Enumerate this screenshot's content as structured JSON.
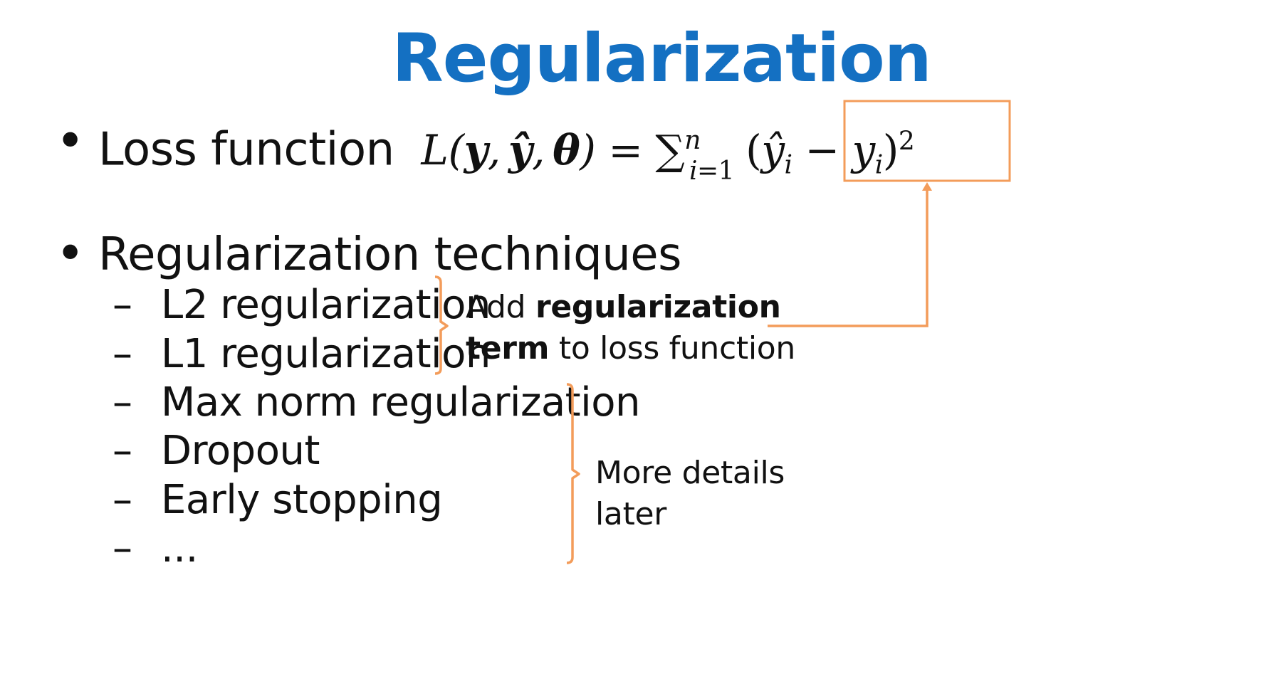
{
  "slide": {
    "title": "Regularization",
    "bullet1_label": "Loss function",
    "bullet2_label": "Regularization techniques",
    "techniques": [
      "L2 regularization",
      "L1 regularization",
      "Max norm regularization",
      "Dropout",
      "Early stopping",
      "..."
    ],
    "dash": "–",
    "note_add_1": "Add",
    "note_add_bold_1": "regularization",
    "note_add_bold_2": "term",
    "note_add_2": "to loss function",
    "note_later_1": "More details",
    "note_later_2": "later"
  },
  "colors": {
    "title": "#1470c2",
    "accent": "#f39c5a"
  }
}
